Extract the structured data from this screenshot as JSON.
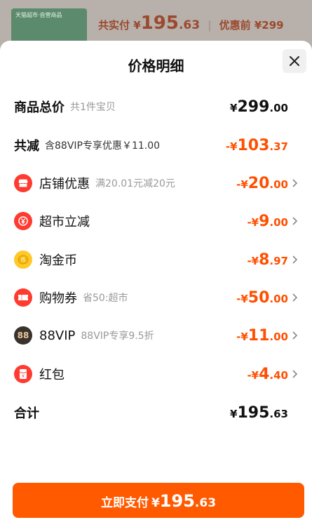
{
  "background": {
    "thumb_tag": "天猫超市·自营商品",
    "paid_label": "共实付",
    "paid_symbol": "¥",
    "paid_int": "195",
    "paid_dec": ".63",
    "before_label": "优惠前",
    "before_value": "¥299"
  },
  "sheet": {
    "title": "价格明细",
    "close_icon": "close-icon"
  },
  "rows": {
    "total": {
      "label": "商品总价",
      "sub": "共1件宝贝",
      "sym": "¥",
      "int": "299",
      "dec": ".00"
    },
    "reduce": {
      "label": "共减",
      "sub": "含88VIP专享优惠￥11.00",
      "sym": "-¥",
      "int": "103",
      "dec": ".37"
    },
    "store": {
      "label": "店铺优惠",
      "sub": "满20.01元减20元",
      "sym": "-¥",
      "int": "20",
      "dec": ".00",
      "icon": "store-icon"
    },
    "market": {
      "label": "超市立减",
      "sym": "-¥",
      "int": "9",
      "dec": ".00",
      "icon": "yen-discount-icon"
    },
    "coin": {
      "label": "淘金币",
      "sym": "-¥",
      "int": "8",
      "dec": ".97",
      "icon": "gold-coin-icon"
    },
    "coupon": {
      "label": "购物券",
      "sub": "省50:超市",
      "sym": "-¥",
      "int": "50",
      "dec": ".00",
      "icon": "coupon-icon"
    },
    "vip": {
      "label": "88VIP",
      "sub": "88VIP专享9.5折",
      "sym": "-¥",
      "int": "11",
      "dec": ".00",
      "icon": "88vip-icon",
      "icon_text": "88"
    },
    "redpacket": {
      "label": "红包",
      "sym": "-¥",
      "int": "4",
      "dec": ".40",
      "icon": "red-packet-icon"
    },
    "sum": {
      "label": "合计",
      "sym": "¥",
      "int": "195",
      "dec": ".63"
    }
  },
  "pay": {
    "label": "立即支付",
    "sym": "¥",
    "int": "195",
    "dec": ".63"
  },
  "colors": {
    "accent": "#ff5000",
    "button": "#ff5a00",
    "icon_red": "#ff3b30",
    "icon_gold": "#ffc92a"
  }
}
